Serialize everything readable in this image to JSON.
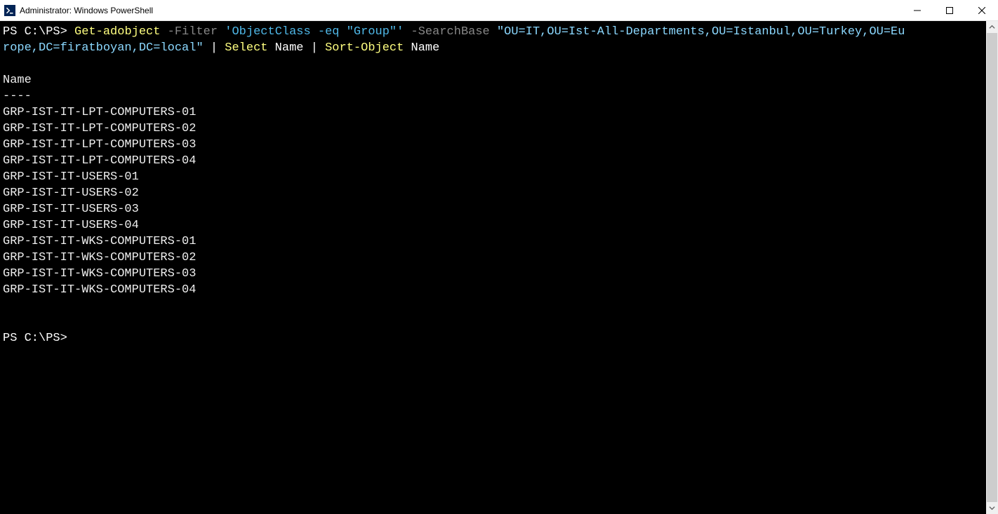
{
  "window": {
    "title": "Administrator: Windows PowerShell"
  },
  "command": {
    "prompt1": "PS C:\\PS> ",
    "cmdlet": "Get-adobject",
    "space1": " ",
    "filterParam": "-Filter",
    "space2": " ",
    "filterValue": "'ObjectClass -eq \"Group\"'",
    "space3": " ",
    "searchBaseParam": "-SearchBase",
    "space4": " ",
    "searchBaseValue1": "\"OU=IT,OU=Ist-All-Departments,OU=Istanbul,OU=Turkey,OU=Eu",
    "searchBaseValue2": "rope,DC=firatboyan,DC=local\"",
    "pipe1": " | ",
    "select": "Select",
    "selectArg": " Name ",
    "pipe2": "| ",
    "sort": "Sort-Object",
    "sortArg": " Name"
  },
  "output": {
    "header": "Name",
    "divider": "----",
    "rows": [
      "GRP-IST-IT-LPT-COMPUTERS-01",
      "GRP-IST-IT-LPT-COMPUTERS-02",
      "GRP-IST-IT-LPT-COMPUTERS-03",
      "GRP-IST-IT-LPT-COMPUTERS-04",
      "GRP-IST-IT-USERS-01",
      "GRP-IST-IT-USERS-02",
      "GRP-IST-IT-USERS-03",
      "GRP-IST-IT-USERS-04",
      "GRP-IST-IT-WKS-COMPUTERS-01",
      "GRP-IST-IT-WKS-COMPUTERS-02",
      "GRP-IST-IT-WKS-COMPUTERS-03",
      "GRP-IST-IT-WKS-COMPUTERS-04"
    ],
    "prompt2": "PS C:\\PS>"
  }
}
